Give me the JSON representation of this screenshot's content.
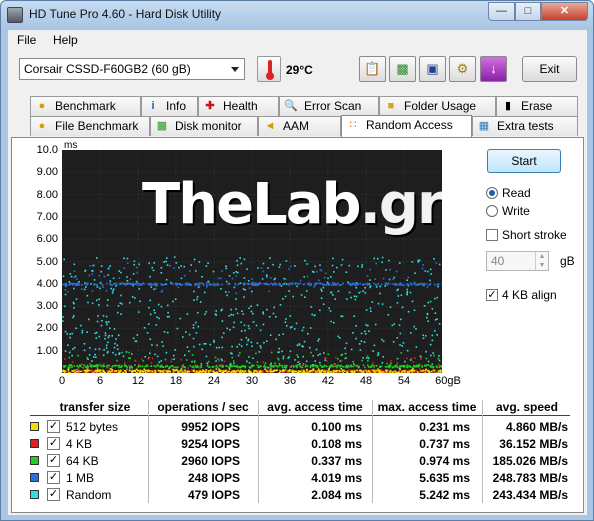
{
  "window": {
    "title": "HD Tune Pro 4.60 - Hard Disk Utility"
  },
  "menu": {
    "file": "File",
    "help": "Help"
  },
  "toolbar": {
    "drive": "Corsair CSSD-F60GB2 (60 gB)",
    "temperature": "29°C",
    "exit_label": "Exit"
  },
  "tabs_row1": [
    {
      "label": "Benchmark",
      "icon": "benchmark-icon"
    },
    {
      "label": "Info",
      "icon": "info-icon"
    },
    {
      "label": "Health",
      "icon": "health-icon"
    },
    {
      "label": "Error Scan",
      "icon": "error-scan-icon"
    },
    {
      "label": "Folder Usage",
      "icon": "folder-icon"
    },
    {
      "label": "Erase",
      "icon": "trash-icon"
    }
  ],
  "tabs_row2": [
    {
      "label": "File Benchmark",
      "icon": "file-benchmark-icon"
    },
    {
      "label": "Disk monitor",
      "icon": "disk-monitor-icon"
    },
    {
      "label": "AAM",
      "icon": "speaker-icon"
    },
    {
      "label": "Random Access",
      "icon": "random-access-icon",
      "active": true
    },
    {
      "label": "Extra tests",
      "icon": "extra-tests-icon"
    }
  ],
  "chart_data": {
    "type": "scatter",
    "title": "",
    "ylabel": "ms",
    "xlabel": "",
    "ylim": [
      0,
      10
    ],
    "xlim": [
      0,
      60
    ],
    "y_ticks": [
      "10.0",
      "9.00",
      "8.00",
      "7.00",
      "6.00",
      "5.00",
      "4.00",
      "3.00",
      "2.00",
      "1.00"
    ],
    "x_ticks": [
      "0",
      "6",
      "12",
      "18",
      "24",
      "30",
      "36",
      "42",
      "48",
      "54",
      "60gB"
    ],
    "series": [
      {
        "name": "512 bytes",
        "color": "#f0e000",
        "avg_ms": 0.1,
        "max_ms": 0.231
      },
      {
        "name": "4 KB",
        "color": "#e02020",
        "avg_ms": 0.108,
        "max_ms": 0.737
      },
      {
        "name": "64 KB",
        "color": "#20d020",
        "avg_ms": 0.337,
        "max_ms": 0.974
      },
      {
        "name": "1 MB",
        "color": "#2a6fdc",
        "avg_ms": 4.019,
        "max_ms": 5.635
      },
      {
        "name": "Random",
        "color": "#30e0e0",
        "avg_ms": 2.084,
        "max_ms": 5.242
      }
    ],
    "grid": true
  },
  "watermark": {
    "main": "TheLab",
    "suffix": ".gr"
  },
  "side": {
    "start_label": "Start",
    "read_label": "Read",
    "write_label": "Write",
    "mode": "read",
    "short_stroke_label": "Short stroke",
    "short_stroke_checked": false,
    "short_stroke_value": "40",
    "gb_label": "gB",
    "align_label": "4 KB align",
    "align_checked": true
  },
  "results": {
    "headers": [
      "transfer size",
      "operations / sec",
      "avg. access time",
      "max. access time",
      "avg. speed"
    ],
    "rows": [
      {
        "name": "512 bytes",
        "color": "#f0e000",
        "ops": "9952 IOPS",
        "avg": "0.100 ms",
        "max": "0.231 ms",
        "speed": "4.860 MB/s"
      },
      {
        "name": "4 KB",
        "color": "#e02020",
        "ops": "9254 IOPS",
        "avg": "0.108 ms",
        "max": "0.737 ms",
        "speed": "36.152 MB/s"
      },
      {
        "name": "64 KB",
        "color": "#20d020",
        "ops": "2960 IOPS",
        "avg": "0.337 ms",
        "max": "0.974 ms",
        "speed": "185.026 MB/s"
      },
      {
        "name": "1 MB",
        "color": "#2a6fdc",
        "ops": "248 IOPS",
        "avg": "4.019 ms",
        "max": "5.635 ms",
        "speed": "248.783 MB/s"
      },
      {
        "name": "Random",
        "color": "#30e0e0",
        "ops": "479 IOPS",
        "avg": "2.084 ms",
        "max": "5.242 ms",
        "speed": "243.434 MB/s"
      }
    ]
  }
}
